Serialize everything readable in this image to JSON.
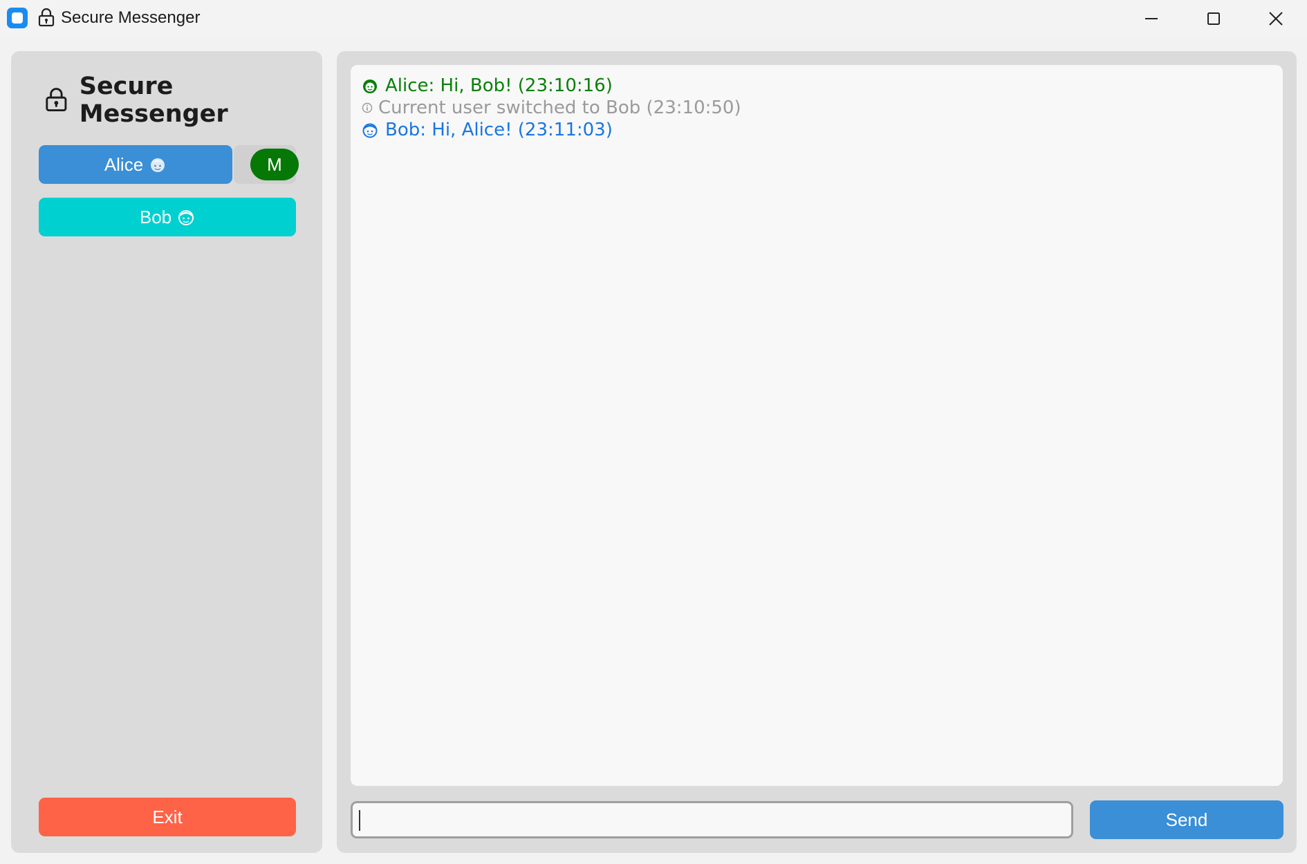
{
  "window": {
    "title": "Secure Messenger",
    "icons": [
      "app-icon",
      "lock-icon",
      "minimize-icon",
      "maximize-icon",
      "close-icon"
    ]
  },
  "sidebar": {
    "title": "Secure Messenger",
    "users": [
      {
        "label": "Alice",
        "color": "#3a8fd6",
        "icon": "face-icon"
      },
      {
        "label": "Bob",
        "color": "#00d0d0",
        "icon": "face-icon"
      }
    ],
    "badge": "M",
    "badge_color": "#067806",
    "exit_label": "Exit",
    "exit_color": "#ff6347"
  },
  "chat": {
    "messages": [
      {
        "kind": "user",
        "text": "Alice: Hi, Bob! (23:10:16)",
        "color": "#0a7f0a"
      },
      {
        "kind": "system",
        "text": "Current user switched to Bob (23:10:50)",
        "color": "#9a9a9a"
      },
      {
        "kind": "user",
        "text": "Bob: Hi, Alice! (23:11:03)",
        "color": "#1976e0"
      }
    ],
    "input_value": "",
    "send_label": "Send"
  }
}
